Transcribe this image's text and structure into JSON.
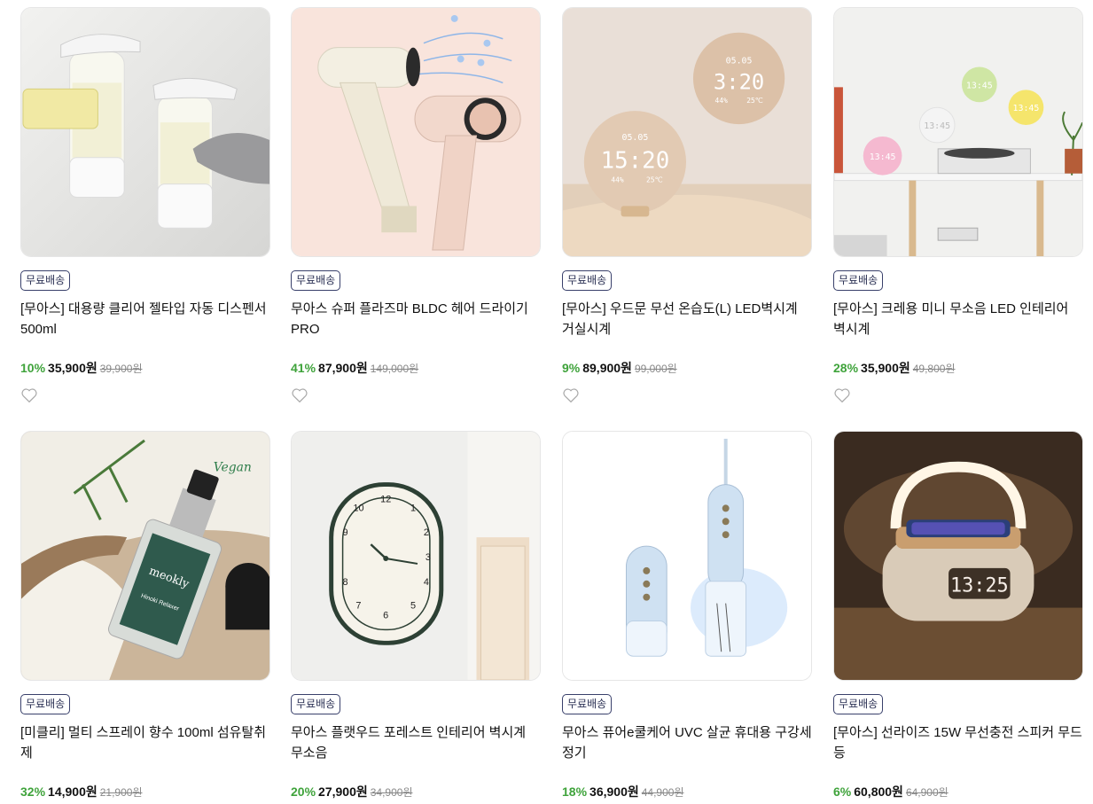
{
  "products": [
    {
      "badge": "무료배송",
      "title": "[무아스] 대용량 클리어 젤타입 자동 디스펜서 500ml",
      "discount": "10%",
      "price": "35,900원",
      "original": "39,900원",
      "image": "dispenser"
    },
    {
      "badge": "무료배송",
      "title": "무아스 슈퍼 플라즈마 BLDC 헤어 드라이기 PRO",
      "discount": "41%",
      "price": "87,900원",
      "original": "149,000원",
      "image": "hair-dryer"
    },
    {
      "badge": "무료배송",
      "title": "[무아스] 우드문 무선 온습도(L) LED벽시계 거실시계",
      "discount": "9%",
      "price": "89,900원",
      "original": "99,000원",
      "image": "wood-moon-clock",
      "clock": {
        "date": "05.05",
        "time_a": "3:20",
        "time_b": "15:20",
        "hum": "44%",
        "temp": "25℃"
      }
    },
    {
      "badge": "무료배송",
      "title": "[무아스] 크레용 미니 무소음 LED 인테리어 벽시계",
      "discount": "28%",
      "price": "35,900원",
      "original": "49,800원",
      "image": "crayon-clocks",
      "clock": {
        "time": "13:45"
      }
    },
    {
      "badge": "무료배송",
      "title": "[미클리] 멀티 스프레이 향수 100ml 섬유탈취제",
      "discount": "32%",
      "price": "14,900원",
      "original": "21,900원",
      "image": "spray-perfume",
      "label": {
        "brand": "meokly",
        "product": "Hinoki Relaxer",
        "vegan": "Vegan"
      }
    },
    {
      "badge": "무료배송",
      "title": "무아스 플랫우드 포레스트 인테리어 벽시계 무소음",
      "discount": "20%",
      "price": "27,900원",
      "original": "34,900원",
      "image": "wall-clock",
      "dial": [
        "12",
        "1",
        "2",
        "3",
        "4",
        "5",
        "6",
        "7",
        "8",
        "9",
        "10",
        "11"
      ]
    },
    {
      "badge": "무료배송",
      "title": "무아스 퓨어e쿨케어 UVC 살균 휴대용 구강세정기",
      "discount": "18%",
      "price": "36,900원",
      "original": "44,900원",
      "image": "oral-irrigator"
    },
    {
      "badge": "무료배송",
      "title": "[무아스] 선라이즈 15W 무선충전 스피커 무드등",
      "discount": "6%",
      "price": "60,800원",
      "original": "64,900원",
      "image": "sunrise-speaker",
      "clock": {
        "time": "13:25"
      }
    }
  ],
  "colors": {
    "discount": "#3fa33b",
    "badge_border": "#39406b"
  }
}
